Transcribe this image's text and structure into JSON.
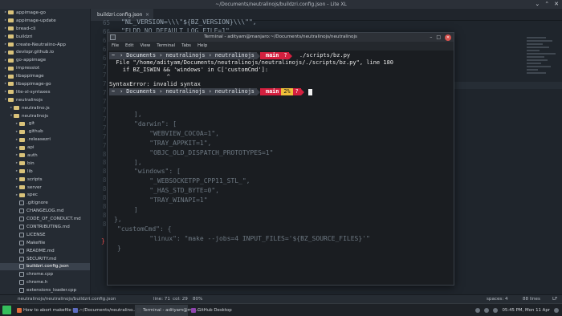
{
  "editor_window": {
    "title": "~/Documents/neutralinojs/buildzri.config.json - Lite XL",
    "controls": [
      "⌄",
      "⌃",
      "✕"
    ]
  },
  "tab": {
    "label": "buildzri.config.json"
  },
  "sidebar": {
    "items": [
      {
        "label": "appimage-go",
        "type": "folder",
        "arrow": "▸",
        "indent": 0
      },
      {
        "label": "appimage-update",
        "type": "folder",
        "arrow": "▸",
        "indent": 0
      },
      {
        "label": "bread-cli",
        "type": "folder",
        "arrow": "▸",
        "indent": 0
      },
      {
        "label": "buildzri",
        "type": "folder",
        "arrow": "▸",
        "indent": 0
      },
      {
        "label": "create-Neutralino-App",
        "type": "folder",
        "arrow": "▸",
        "indent": 0
      },
      {
        "label": "devlopr.github.io",
        "type": "folder",
        "arrow": "▸",
        "indent": 0
      },
      {
        "label": "go-appimage",
        "type": "folder",
        "arrow": "▸",
        "indent": 0
      },
      {
        "label": "impressiot",
        "type": "folder",
        "arrow": "▸",
        "indent": 0
      },
      {
        "label": "libappimage",
        "type": "folder",
        "arrow": "▸",
        "indent": 0
      },
      {
        "label": "libappimage-go",
        "type": "folder",
        "arrow": "▸",
        "indent": 0
      },
      {
        "label": "lite-xl-syntaxes",
        "type": "folder",
        "arrow": "▸",
        "indent": 0
      },
      {
        "label": "neutralinojs",
        "type": "folder",
        "arrow": "▾",
        "indent": 0
      },
      {
        "label": "neutralino.js",
        "type": "folder",
        "arrow": "▸",
        "indent": 1
      },
      {
        "label": "neutralinojs",
        "type": "folder",
        "arrow": "▾",
        "indent": 1
      },
      {
        "label": ".git",
        "type": "folder",
        "arrow": "▸",
        "indent": 2
      },
      {
        "label": ".github",
        "type": "folder",
        "arrow": "▸",
        "indent": 2
      },
      {
        "label": ".releasezri",
        "type": "folder",
        "arrow": "▸",
        "indent": 2
      },
      {
        "label": "api",
        "type": "folder",
        "arrow": "▸",
        "indent": 2
      },
      {
        "label": "auth",
        "type": "folder",
        "arrow": "▸",
        "indent": 2
      },
      {
        "label": "bin",
        "type": "folder",
        "arrow": "▸",
        "indent": 2
      },
      {
        "label": "lib",
        "type": "folder",
        "arrow": "▸",
        "indent": 2
      },
      {
        "label": "scripts",
        "type": "folder",
        "arrow": "▸",
        "indent": 2
      },
      {
        "label": "server",
        "type": "folder",
        "arrow": "▸",
        "indent": 2
      },
      {
        "label": "spec",
        "type": "folder",
        "arrow": "▸",
        "indent": 2
      },
      {
        "label": ".gitignore",
        "type": "file",
        "arrow": "",
        "indent": 2
      },
      {
        "label": "CHANGELOG.md",
        "type": "file",
        "arrow": "",
        "indent": 2
      },
      {
        "label": "CODE_OF_CONDUCT.md",
        "type": "file",
        "arrow": "",
        "indent": 2
      },
      {
        "label": "CONTRIBUTING.md",
        "type": "file",
        "arrow": "",
        "indent": 2
      },
      {
        "label": "LICENSE",
        "type": "file",
        "arrow": "",
        "indent": 2
      },
      {
        "label": "Makefile",
        "type": "file",
        "arrow": "",
        "indent": 2
      },
      {
        "label": "README.md",
        "type": "file",
        "arrow": "",
        "indent": 2
      },
      {
        "label": "SECURITY.md",
        "type": "file",
        "arrow": "",
        "indent": 2
      },
      {
        "label": "buildzri.config.json",
        "type": "file",
        "arrow": "",
        "indent": 2,
        "active": true
      },
      {
        "label": "chrome.cpp",
        "type": "file",
        "arrow": "",
        "indent": 2
      },
      {
        "label": "chrome.h",
        "type": "file",
        "arrow": "",
        "indent": 2
      },
      {
        "label": "extensions_loader.cpp",
        "type": "file",
        "arrow": "",
        "indent": 2
      }
    ]
  },
  "editor": {
    "line_numbers": [
      "65",
      "66",
      "67",
      "68",
      "69",
      "70",
      "71",
      "72",
      "73",
      "74",
      "75",
      "76",
      "77",
      "78",
      "79",
      "80",
      "81",
      "82",
      "83",
      "84",
      "85",
      "86",
      "87",
      "88"
    ],
    "top_lines": [
      "\"NL_VERSION=\\\\\\\"${BZ_VERSION}\\\\\\\"\",",
      "\"ELDD NO DEFAULT LOG FILE=1\""
    ],
    "background_lines": [
      "],",
      "\"darwin\": [",
      "    \"WEBVIEW_COCOA=1\",",
      "    \"TRAY_APPKIT=1\",",
      "    \"OBJC_OLD_DISPATCH_PROTOTYPES=1\"",
      "],",
      "\"windows\": [",
      "    \"_WEBSOCKETPP_CPP11_STL_\",",
      "    \"_HAS_STD_BYTE=0\",",
      "    \"TRAY_WINAPI=1\"",
      "]",
      "},",
      "\"customCmd\": {",
      "    \"linux\": \"make --jobs=4 INPUT_FILES='${BZ_SOURCE_FILES}'\"",
      "}"
    ],
    "closing_brace": "}"
  },
  "terminal": {
    "title": "Terminal - adityam@manjaro:~/Documents/neutralinojs/neutralinojs",
    "menu": [
      "File",
      "Edit",
      "View",
      "Terminal",
      "Tabs",
      "Help"
    ],
    "prompt1": {
      "segments": [
        "~",
        "Documents",
        "neutralinojs",
        "neutralinojs"
      ],
      "branch": "main",
      "status": "?",
      "command": "./scripts/bz.py"
    },
    "output": [
      "  File \"/home/adityam/Documents/neutralinojs/neutralinojs/./scripts/bz.py\", line 180",
      "    if BZ_ISWIN && 'windows' in C['customCmd']:",
      "                 ^",
      "SyntaxError: invalid syntax"
    ],
    "prompt2": {
      "segments": [
        "~",
        "Documents",
        "neutralinojs",
        "neutralinojs"
      ],
      "branch": "main",
      "percent": "2%",
      "status": "?"
    }
  },
  "statusbar": {
    "path": "neutralinojs/neutralinojs/buildzri.config.json",
    "line": "line: 71",
    "col": "col: 29",
    "zoom": "80%",
    "spaces": "spaces: 4",
    "lines": "88 lines",
    "eol": "LF"
  },
  "taskbar": {
    "items": [
      {
        "label": "How to abort makefile if ...",
        "color": "#e06c3c"
      },
      {
        "label": "~/Documents/neutralino...",
        "color": "#5c6bc0"
      },
      {
        "label": "Terminal - adityam@ma...",
        "color": "#3a3f46",
        "active": true
      },
      {
        "label": "GitHub Desktop",
        "color": "#8e44ad"
      }
    ],
    "clock": "05:45 PM, Mon 11 Apr"
  }
}
